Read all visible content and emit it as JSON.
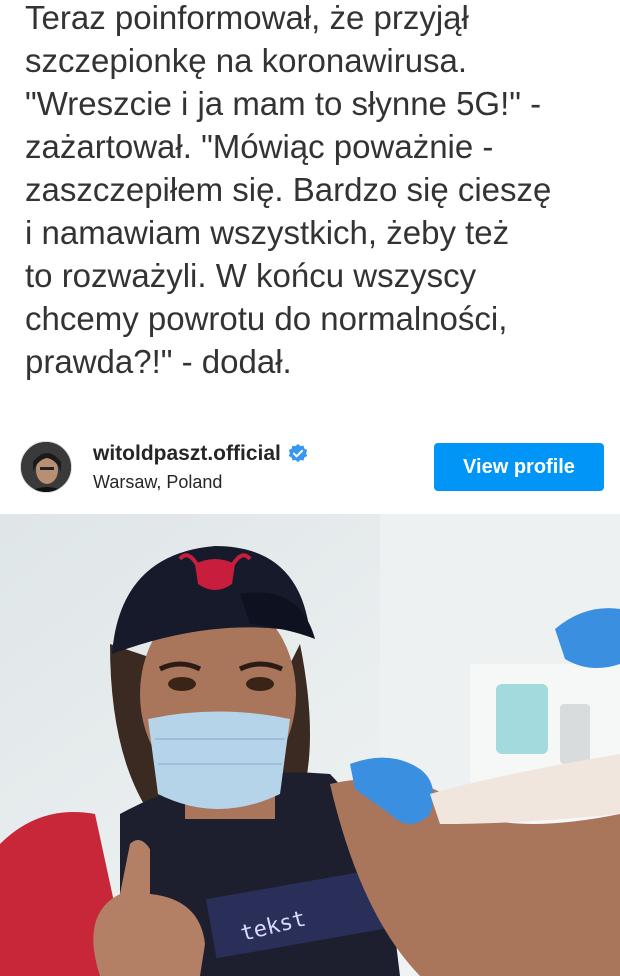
{
  "article": {
    "text": "Teraz poinformował, że przyjął\nszczepionkę na koronawirusa.\n\"Wreszcie i ja mam to słynne 5G!\" -\nzażartował. \"Mówiąc poważnie -\nzaszczepiłem się. Bardzo się cieszę\ni namawiam wszystkich, żeby też\nto rozważyli. W końcu wszyscy\nchcemy powrotu do normalności,\nprawda?!\" - dodał."
  },
  "embed": {
    "username": "witoldpaszt.official",
    "location": "Warsaw, Poland",
    "view_profile_label": "View profile",
    "verified_icon": "verified-badge-icon"
  },
  "image": {
    "shirt_text": "tekst"
  },
  "colors": {
    "button": "#0095f6",
    "text": "#333333",
    "verified": "#3897f0"
  }
}
